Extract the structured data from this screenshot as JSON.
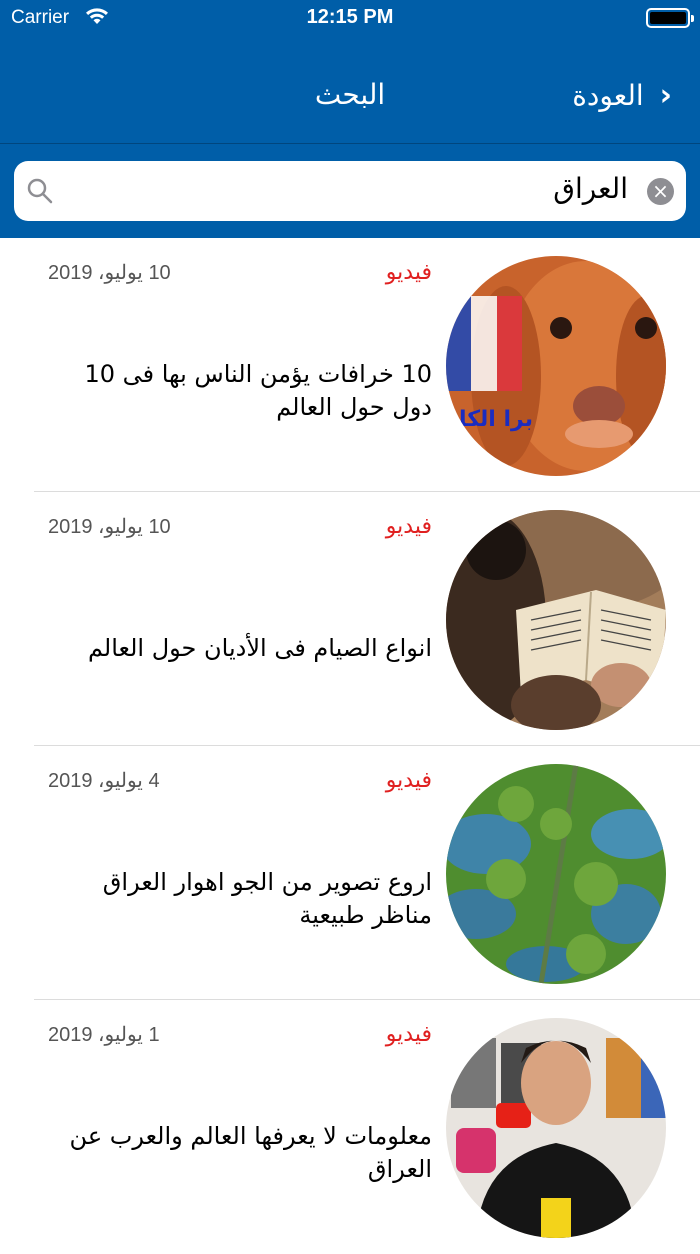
{
  "status": {
    "carrier": "Carrier",
    "time": "12:15 PM"
  },
  "nav": {
    "title": "البحث",
    "back_label": "العودة"
  },
  "search": {
    "value": "العراق"
  },
  "results": [
    {
      "category": "فيديو",
      "date": "10 يوليو، 2019",
      "title": "10 خرافات يؤمن الناس بها فى 10 دول حول العالم",
      "thumb_overlay": "برا الكا"
    },
    {
      "category": "فيديو",
      "date": "10 يوليو، 2019",
      "title": "انواع الصيام فى الأديان حول العالم"
    },
    {
      "category": "فيديو",
      "date": "4 يوليو، 2019",
      "title": "اروع تصوير من الجو اهوار العراق مناظر طبيعية"
    },
    {
      "category": "فيديو",
      "date": "1 يوليو، 2019",
      "title": "معلومات لا يعرفها العالم والعرب عن العراق"
    }
  ],
  "colors": {
    "header": "#005ea8",
    "category": "#e02020"
  }
}
